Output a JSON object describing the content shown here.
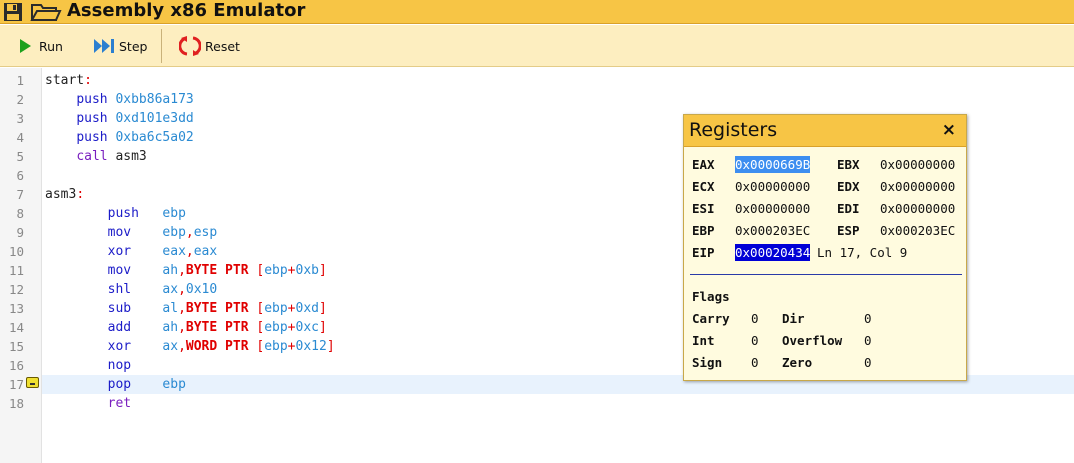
{
  "app": {
    "title": "Assembly x86 Emulator"
  },
  "toolbar": {
    "run_label": "Run",
    "step_label": "Step",
    "reset_label": "Reset"
  },
  "editor": {
    "line_numbers": [
      "1",
      "2",
      "3",
      "4",
      "5",
      "6",
      "7",
      "8",
      "9",
      "10",
      "11",
      "12",
      "13",
      "14",
      "15",
      "16",
      "17",
      "18"
    ],
    "current_line": 17,
    "breakpoint_line": 17,
    "code": {
      "l1_label": "start",
      "l2_op": "push",
      "l2_arg": "0xbb86a173",
      "l3_op": "push",
      "l3_arg": "0xd101e3dd",
      "l4_op": "push",
      "l4_arg": "0xba6c5a02",
      "l5_op": "call",
      "l5_arg": "asm3",
      "l7_label": "asm3",
      "l8_op": "push",
      "l8_a1": "ebp",
      "l9_op": "mov",
      "l9_a1": "ebp",
      "l9_a2": "esp",
      "l10_op": "xor",
      "l10_a1": "eax",
      "l10_a2": "eax",
      "l11_op": "mov",
      "l11_a1": "ah",
      "l11_sz": "BYTE PTR",
      "l11_base": "ebp",
      "l11_off": "0xb",
      "l12_op": "shl",
      "l12_a1": "ax",
      "l12_a2": "0x10",
      "l13_op": "sub",
      "l13_a1": "al",
      "l13_sz": "BYTE PTR",
      "l13_base": "ebp",
      "l13_off": "0xd",
      "l14_op": "add",
      "l14_a1": "ah",
      "l14_sz": "BYTE PTR",
      "l14_base": "ebp",
      "l14_off": "0xc",
      "l15_op": "xor",
      "l15_a1": "ax",
      "l15_sz": "WORD PTR",
      "l15_base": "ebp",
      "l15_off": "0x12",
      "l16_op": "nop",
      "l17_op": "pop",
      "l17_a1": "ebp",
      "l18_op": "ret"
    }
  },
  "registers": {
    "title": "Registers",
    "close": "×",
    "eax_label": "EAX",
    "eax": "0x0000669B",
    "ebx_label": "EBX",
    "ebx": "0x00000000",
    "ecx_label": "ECX",
    "ecx": "0x00000000",
    "edx_label": "EDX",
    "edx": "0x00000000",
    "esi_label": "ESI",
    "esi": "0x00000000",
    "edi_label": "EDI",
    "edi": "0x00000000",
    "ebp_label": "EBP",
    "ebp": "0x000203EC",
    "esp_label": "ESP",
    "esp": "0x000203EC",
    "eip_label": "EIP",
    "eip": "0x00020434",
    "position": "Ln 17, Col 9",
    "flags_title": "Flags",
    "carry_label": "Carry",
    "carry": "0",
    "dir_label": "Dir",
    "dir": "0",
    "int_label": "Int",
    "int": "0",
    "overflow_label": "Overflow",
    "overflow": "0",
    "sign_label": "Sign",
    "sign": "0",
    "zero_label": "Zero",
    "zero": "0"
  },
  "colors": {
    "titlebar": "#f7c545",
    "toolbar": "#fdeec0",
    "panel": "#fffbdf",
    "current_line": "#e8f2fd"
  },
  "icons": [
    "save-icon",
    "open-folder-icon",
    "run-icon",
    "step-icon",
    "reset-icon",
    "breakpoint-icon",
    "close-icon"
  ]
}
